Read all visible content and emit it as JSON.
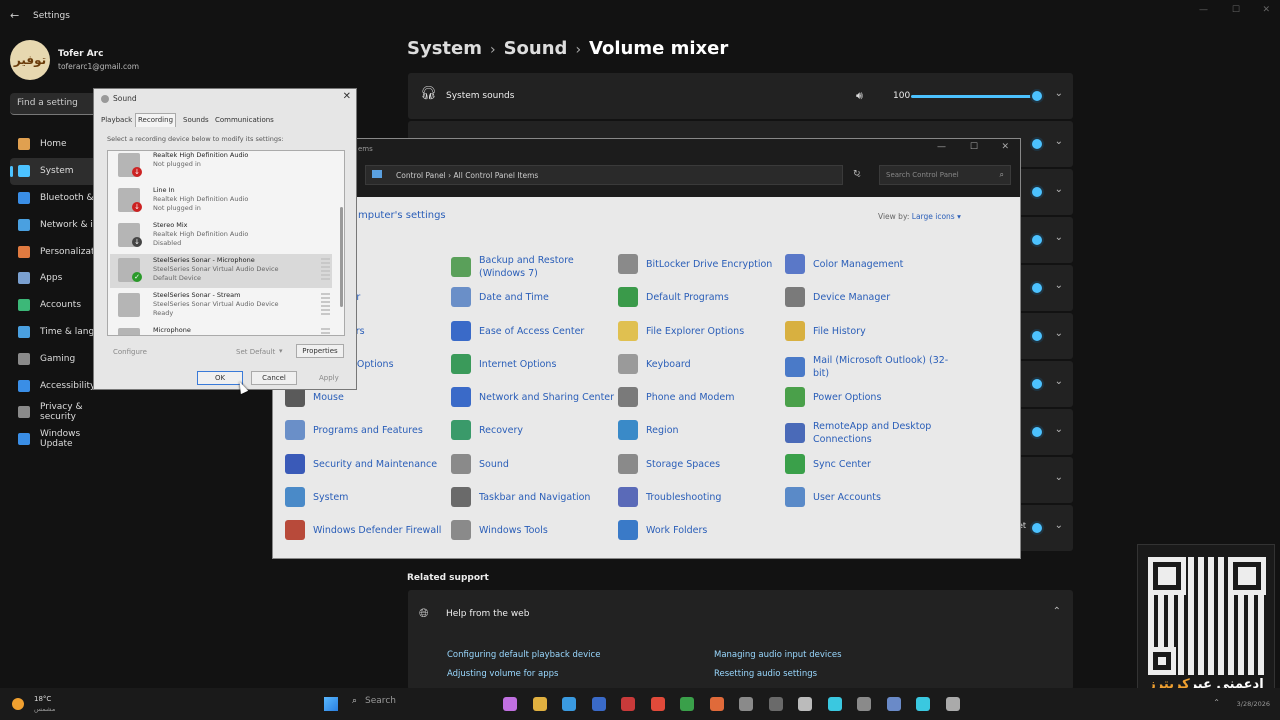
{
  "settings": {
    "window_title": "Settings",
    "profile": {
      "avatar_text": "توفير",
      "name": "Tofer Arc",
      "email": "toferarc1@gmail.com"
    },
    "find_placeholder": "Find a setting",
    "nav": [
      {
        "label": "Home",
        "color": "#e0a050"
      },
      {
        "label": "System",
        "color": "#4cc2ff",
        "active": true
      },
      {
        "label": "Bluetooth & devices",
        "short": "Bluetooth &",
        "color": "#3a8ee6"
      },
      {
        "label": "Network & internet",
        "short": "Network & i",
        "color": "#4aa0e0"
      },
      {
        "label": "Personalization",
        "short": "Personalizati",
        "color": "#e07a40"
      },
      {
        "label": "Apps",
        "color": "#7aa0d0"
      },
      {
        "label": "Accounts",
        "color": "#3cb878"
      },
      {
        "label": "Time & language",
        "short": "Time & langu",
        "color": "#4aa0e0"
      },
      {
        "label": "Gaming",
        "color": "#8a8a8a"
      },
      {
        "label": "Accessibility",
        "color": "#3a8ee6"
      },
      {
        "label": "Privacy & security",
        "color": "#8a8a8a"
      },
      {
        "label": "Windows Update",
        "color": "#3a8ee6"
      }
    ],
    "breadcrumb": [
      "System",
      "Sound",
      "Volume mixer"
    ],
    "system_sounds": {
      "label": "System sounds",
      "volume": "100"
    },
    "reset_partial": "et",
    "related_support": "Related support",
    "help": {
      "title": "Help from the web",
      "links": [
        "Configuring default playback device",
        "Managing audio input devices",
        "Adjusting volume for apps",
        "Resetting audio settings"
      ]
    }
  },
  "control_panel": {
    "title_partial": "ems",
    "address": [
      "Control Panel",
      "All Control Panel Items"
    ],
    "search_placeholder": "Search Control Panel",
    "heading_partial": "mputer's settings",
    "view_by_label": "View by:",
    "view_by_value": "Large icons ▾",
    "items": [
      {
        "label": "Backup and Restore (Windows 7)",
        "color": "#5aa05a"
      },
      {
        "label": "BitLocker Drive Encryption",
        "color": "#8a8a8a"
      },
      {
        "label": "Color Management",
        "color": "#5a78c8"
      },
      {
        "label": "l Manager",
        "color": "#c8a050"
      },
      {
        "label": "Date and Time",
        "color": "#6a8fc8"
      },
      {
        "label": "Default Programs",
        "color": "#3a9a4a"
      },
      {
        "label": "Device Manager",
        "color": "#7a7a7a"
      },
      {
        "label": "nd Printers",
        "color": "#6a6a6a"
      },
      {
        "label": "Ease of Access Center",
        "color": "#3a6ac8"
      },
      {
        "label": "File Explorer Options",
        "color": "#e0c050"
      },
      {
        "label": "File History",
        "color": "#d8b040"
      },
      {
        "label": "Indexing Options",
        "color": "#9a9a9a"
      },
      {
        "label": "Internet Options",
        "color": "#3a9a5a"
      },
      {
        "label": "Keyboard",
        "color": "#9a9a9a"
      },
      {
        "label": "Mail (Microsoft Outlook) (32-bit)",
        "color": "#4a7ac8"
      },
      {
        "label": "Mouse",
        "color": "#5a5a5a"
      },
      {
        "label": "Network and Sharing Center",
        "color": "#3a6ac8"
      },
      {
        "label": "Phone and Modem",
        "color": "#7a7a7a"
      },
      {
        "label": "Power Options",
        "color": "#4aa04a"
      },
      {
        "label": "Programs and Features",
        "color": "#6a8fc8"
      },
      {
        "label": "Recovery",
        "color": "#3a9a6a"
      },
      {
        "label": "Region",
        "color": "#3a8ac8"
      },
      {
        "label": "RemoteApp and Desktop Connections",
        "color": "#4a6ab8"
      },
      {
        "label": "Security and Maintenance",
        "color": "#3a5ab8"
      },
      {
        "label": "Sound",
        "color": "#8a8a8a"
      },
      {
        "label": "Storage Spaces",
        "color": "#8a8a8a"
      },
      {
        "label": "Sync Center",
        "color": "#3aa04a"
      },
      {
        "label": "System",
        "color": "#4a8ac8"
      },
      {
        "label": "Taskbar and Navigation",
        "color": "#6a6a6a"
      },
      {
        "label": "Troubleshooting",
        "color": "#5a6ab8"
      },
      {
        "label": "User Accounts",
        "color": "#5a8ac8"
      },
      {
        "label": "Windows Defender Firewall",
        "color": "#b84a3a"
      },
      {
        "label": "Windows Tools",
        "color": "#8a8a8a"
      },
      {
        "label": "Work Folders",
        "color": "#3a7ac8"
      }
    ]
  },
  "sound_dialog": {
    "title": "Sound",
    "tabs": [
      "Playback",
      "Recording",
      "Sounds",
      "Communications"
    ],
    "instruction": "Select a recording device below to modify its settings:",
    "devices": [
      {
        "name": "Realtek High Definition Audio",
        "sub": "Not plugged in",
        "sub2": "",
        "status": "unplugged"
      },
      {
        "name": "Line In",
        "sub": "Realtek High Definition Audio",
        "sub2": "Not plugged in",
        "status": "unplugged"
      },
      {
        "name": "Stereo Mix",
        "sub": "Realtek High Definition Audio",
        "sub2": "Disabled",
        "status": "disabled"
      },
      {
        "name": "SteelSeries Sonar - Microphone",
        "sub": "SteelSeries Sonar Virtual Audio Device",
        "sub2": "Default Device",
        "status": "default"
      },
      {
        "name": "SteelSeries Sonar - Stream",
        "sub": "SteelSeries Sonar Virtual Audio Device",
        "sub2": "Ready",
        "status": "ready"
      },
      {
        "name": "Microphone",
        "sub": "",
        "sub2": "",
        "status": "ready"
      }
    ],
    "configure": "Configure",
    "set_default": "Set Default",
    "properties": "Properties",
    "ok": "OK",
    "cancel": "Cancel",
    "apply": "Apply"
  },
  "taskbar": {
    "temp": "18°C",
    "weather_desc": "مشمس",
    "search": "Search",
    "apps": [
      "#c070e0",
      "#e0b040",
      "#3a9ae0",
      "#3a6ac8",
      "#c83a3a",
      "#e04a3a",
      "#3aa04a",
      "#e06a3a",
      "#8a8a8a",
      "#6a6a6a",
      "#bbbbbb",
      "#3ac8e0",
      "#8a8a8a",
      "#6a8ac8",
      "#3ac8e0",
      "#aaaaaa"
    ],
    "clock_date": "3/28/2026"
  },
  "watermark": {
    "text": "إدعمني عبر",
    "brand": "كريترز"
  }
}
